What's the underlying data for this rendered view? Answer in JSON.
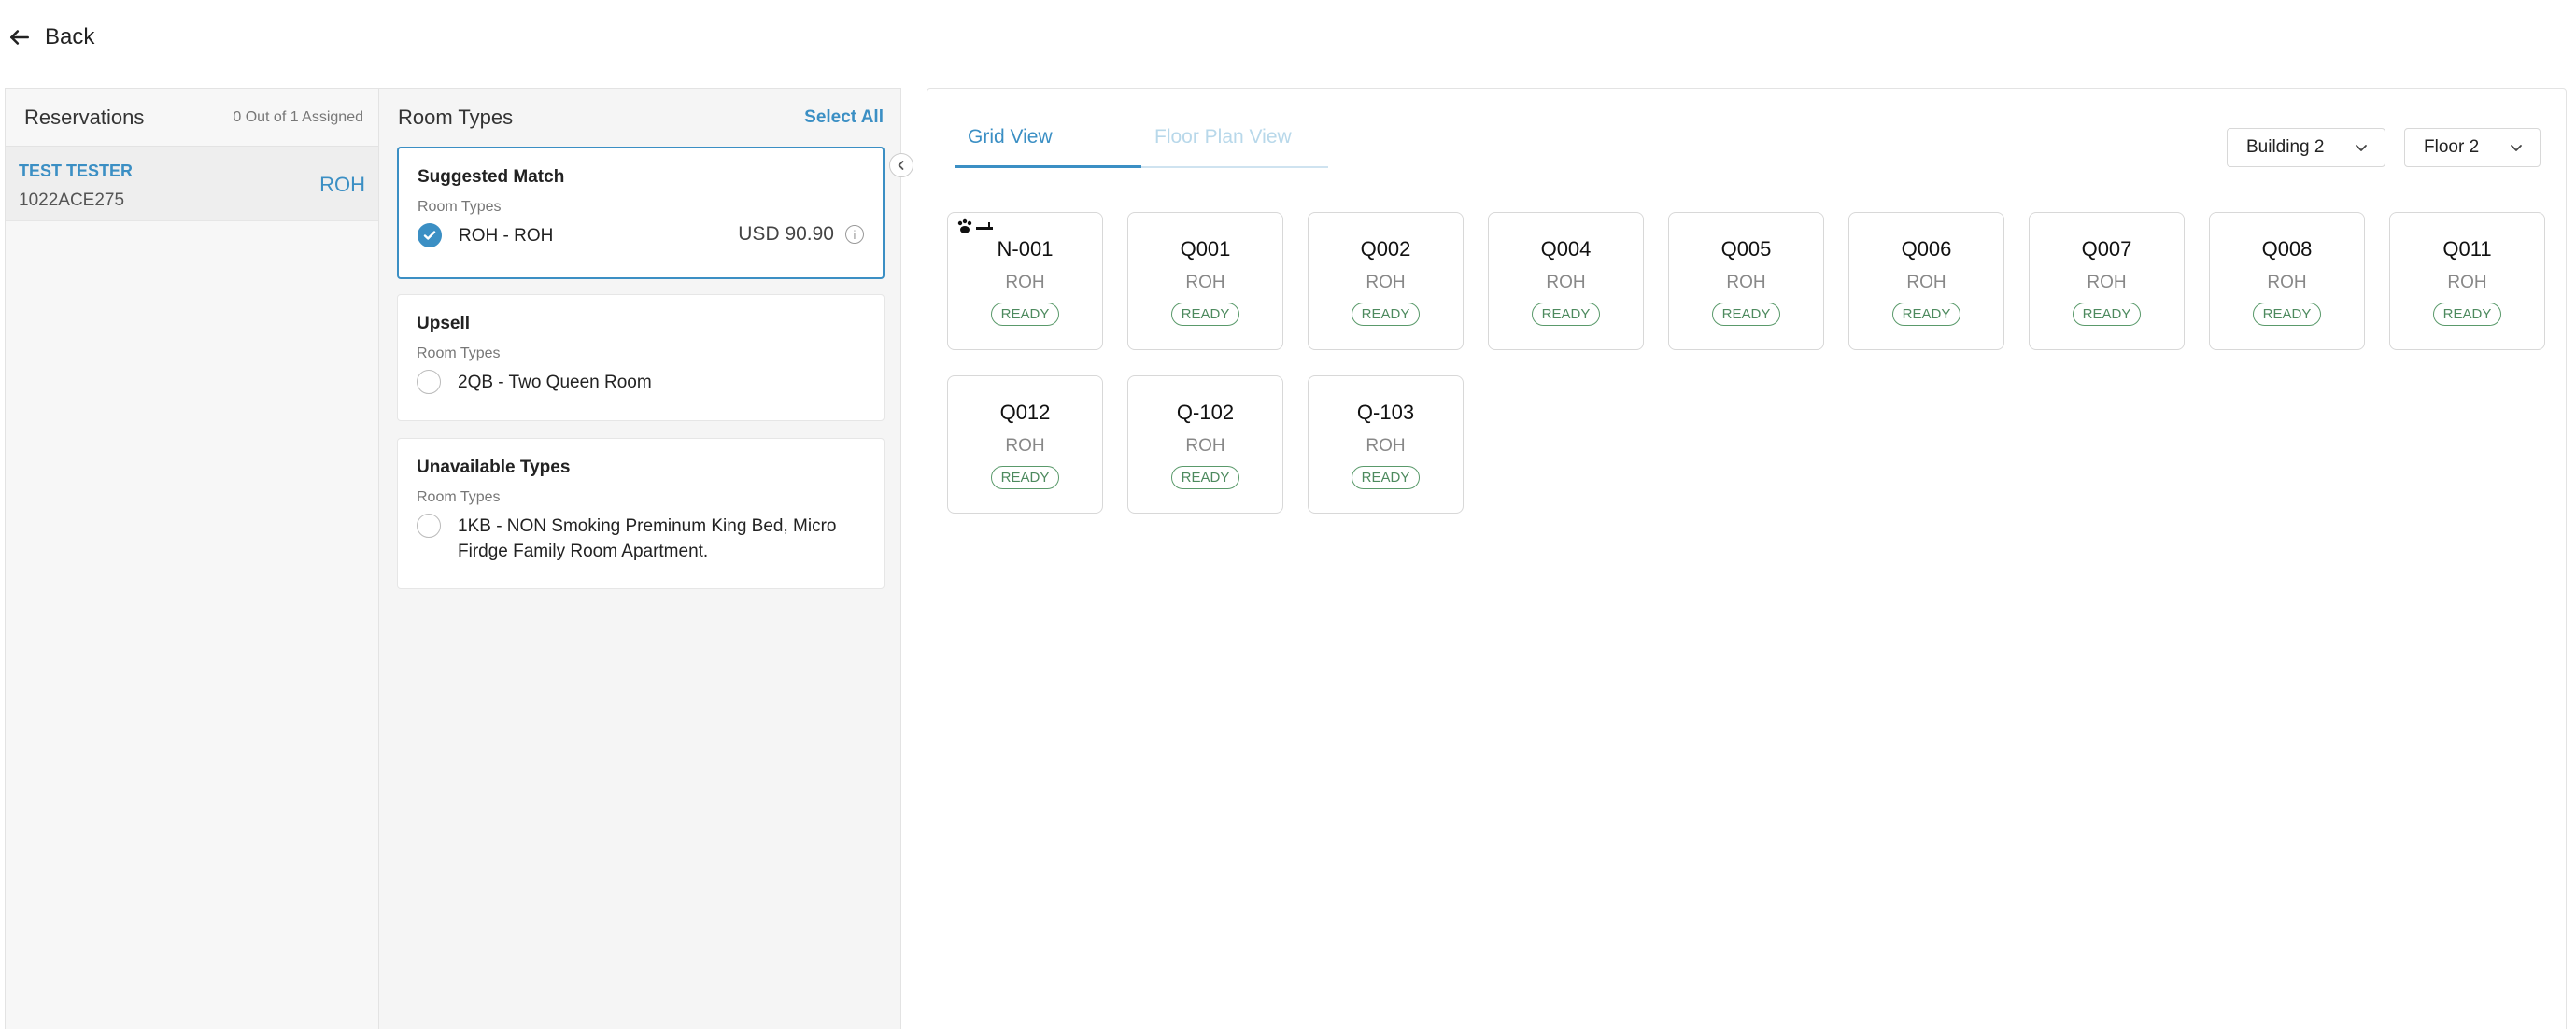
{
  "back": {
    "label": "Back"
  },
  "reservations": {
    "title": "Reservations",
    "assigned_count": "0 Out of 1 Assigned",
    "items": [
      {
        "name": "TEST TESTER",
        "code": "1022ACE275",
        "room_type": "ROH"
      }
    ]
  },
  "room_types": {
    "title": "Room Types",
    "select_all": "Select All",
    "suggested": {
      "title": "Suggested Match",
      "subtitle": "Room Types",
      "option": "ROH - ROH",
      "price": "USD 90.90",
      "checked": true
    },
    "upsell": {
      "title": "Upsell",
      "subtitle": "Room Types",
      "option": "2QB - Two Queen Room"
    },
    "unavailable": {
      "title": "Unavailable Types",
      "subtitle": "Room Types",
      "option": "1KB - NON Smoking Preminum King Bed, Micro Firdge Family Room Apartment."
    }
  },
  "view_tabs": [
    {
      "label": "Grid View",
      "active": true
    },
    {
      "label": "Floor Plan View",
      "active": false
    }
  ],
  "filters": {
    "building": "Building 2",
    "floor": "Floor 2"
  },
  "rooms": [
    {
      "number": "N-001",
      "type": "ROH",
      "status": "READY",
      "pet_icon": true
    },
    {
      "number": "Q001",
      "type": "ROH",
      "status": "READY"
    },
    {
      "number": "Q002",
      "type": "ROH",
      "status": "READY"
    },
    {
      "number": "Q004",
      "type": "ROH",
      "status": "READY"
    },
    {
      "number": "Q005",
      "type": "ROH",
      "status": "READY"
    },
    {
      "number": "Q006",
      "type": "ROH",
      "status": "READY"
    },
    {
      "number": "Q007",
      "type": "ROH",
      "status": "READY"
    },
    {
      "number": "Q008",
      "type": "ROH",
      "status": "READY"
    },
    {
      "number": "Q011",
      "type": "ROH",
      "status": "READY"
    },
    {
      "number": "Q012",
      "type": "ROH",
      "status": "READY"
    },
    {
      "number": "Q-102",
      "type": "ROH",
      "status": "READY"
    },
    {
      "number": "Q-103",
      "type": "ROH",
      "status": "READY"
    }
  ],
  "colors": {
    "accent": "#3b8fc4",
    "ready": "#4d8a5e"
  }
}
